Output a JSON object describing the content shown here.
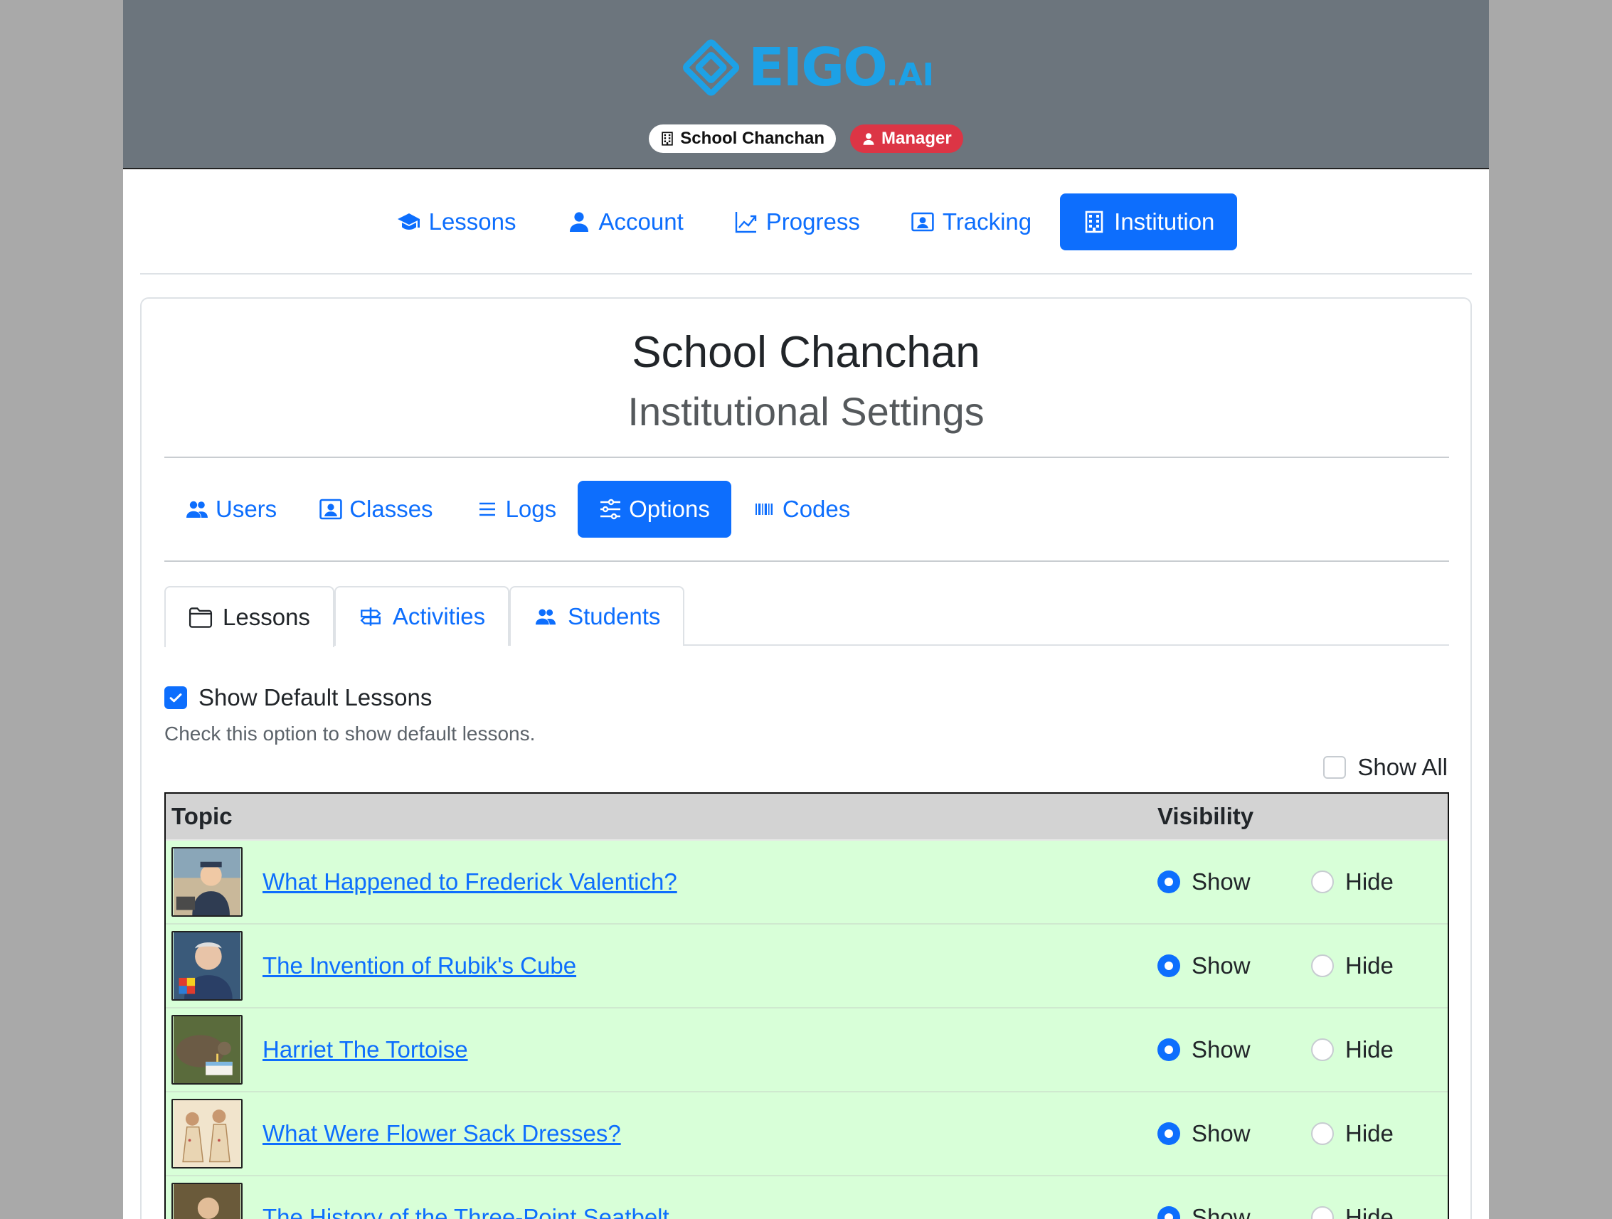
{
  "header": {
    "logo_text": "EIGO",
    "logo_suffix": ".AI",
    "school_badge": "School Chanchan",
    "role_badge": "Manager"
  },
  "main_nav": [
    {
      "label": "Lessons",
      "icon": "graduation-cap-icon",
      "active": false
    },
    {
      "label": "Account",
      "icon": "person-icon",
      "active": false
    },
    {
      "label": "Progress",
      "icon": "graph-up-icon",
      "active": false
    },
    {
      "label": "Tracking",
      "icon": "person-badge-icon",
      "active": false
    },
    {
      "label": "Institution",
      "icon": "building-icon",
      "active": true
    }
  ],
  "card": {
    "title": "School Chanchan",
    "subtitle": "Institutional Settings"
  },
  "sub_nav": [
    {
      "label": "Users",
      "icon": "people-icon",
      "active": false
    },
    {
      "label": "Classes",
      "icon": "person-video-icon",
      "active": false
    },
    {
      "label": "Logs",
      "icon": "list-icon",
      "active": false
    },
    {
      "label": "Options",
      "icon": "sliders-icon",
      "active": true
    },
    {
      "label": "Codes",
      "icon": "barcode-icon",
      "active": false
    }
  ],
  "tabs": [
    {
      "label": "Lessons",
      "icon": "folder-icon",
      "active": true
    },
    {
      "label": "Activities",
      "icon": "signpost-icon",
      "active": false
    },
    {
      "label": "Students",
      "icon": "people-icon",
      "active": false
    }
  ],
  "options": {
    "show_default_label": "Show Default Lessons",
    "show_default_checked": true,
    "show_default_help": "Check this option to show default lessons.",
    "show_all_label": "Show All",
    "show_all_checked": false
  },
  "table": {
    "headers": {
      "topic": "Topic",
      "visibility": "Visibility"
    },
    "show_label": "Show",
    "hide_label": "Hide",
    "rows": [
      {
        "topic": "What Happened to Frederick Valentich?",
        "visibility": "Show"
      },
      {
        "topic": "The Invention of Rubik's Cube",
        "visibility": "Show"
      },
      {
        "topic": "Harriet The Tortoise",
        "visibility": "Show"
      },
      {
        "topic": "What Were Flower Sack Dresses?",
        "visibility": "Show"
      },
      {
        "topic": "The History of the Three-Point Seatbelt",
        "visibility": "Show"
      }
    ]
  },
  "colors": {
    "accent": "#0d6efd",
    "header_bg": "#6c757d",
    "manager_badge": "#dc3545",
    "row_bg": "#d8ffd8",
    "logo": "#1da1e6"
  }
}
